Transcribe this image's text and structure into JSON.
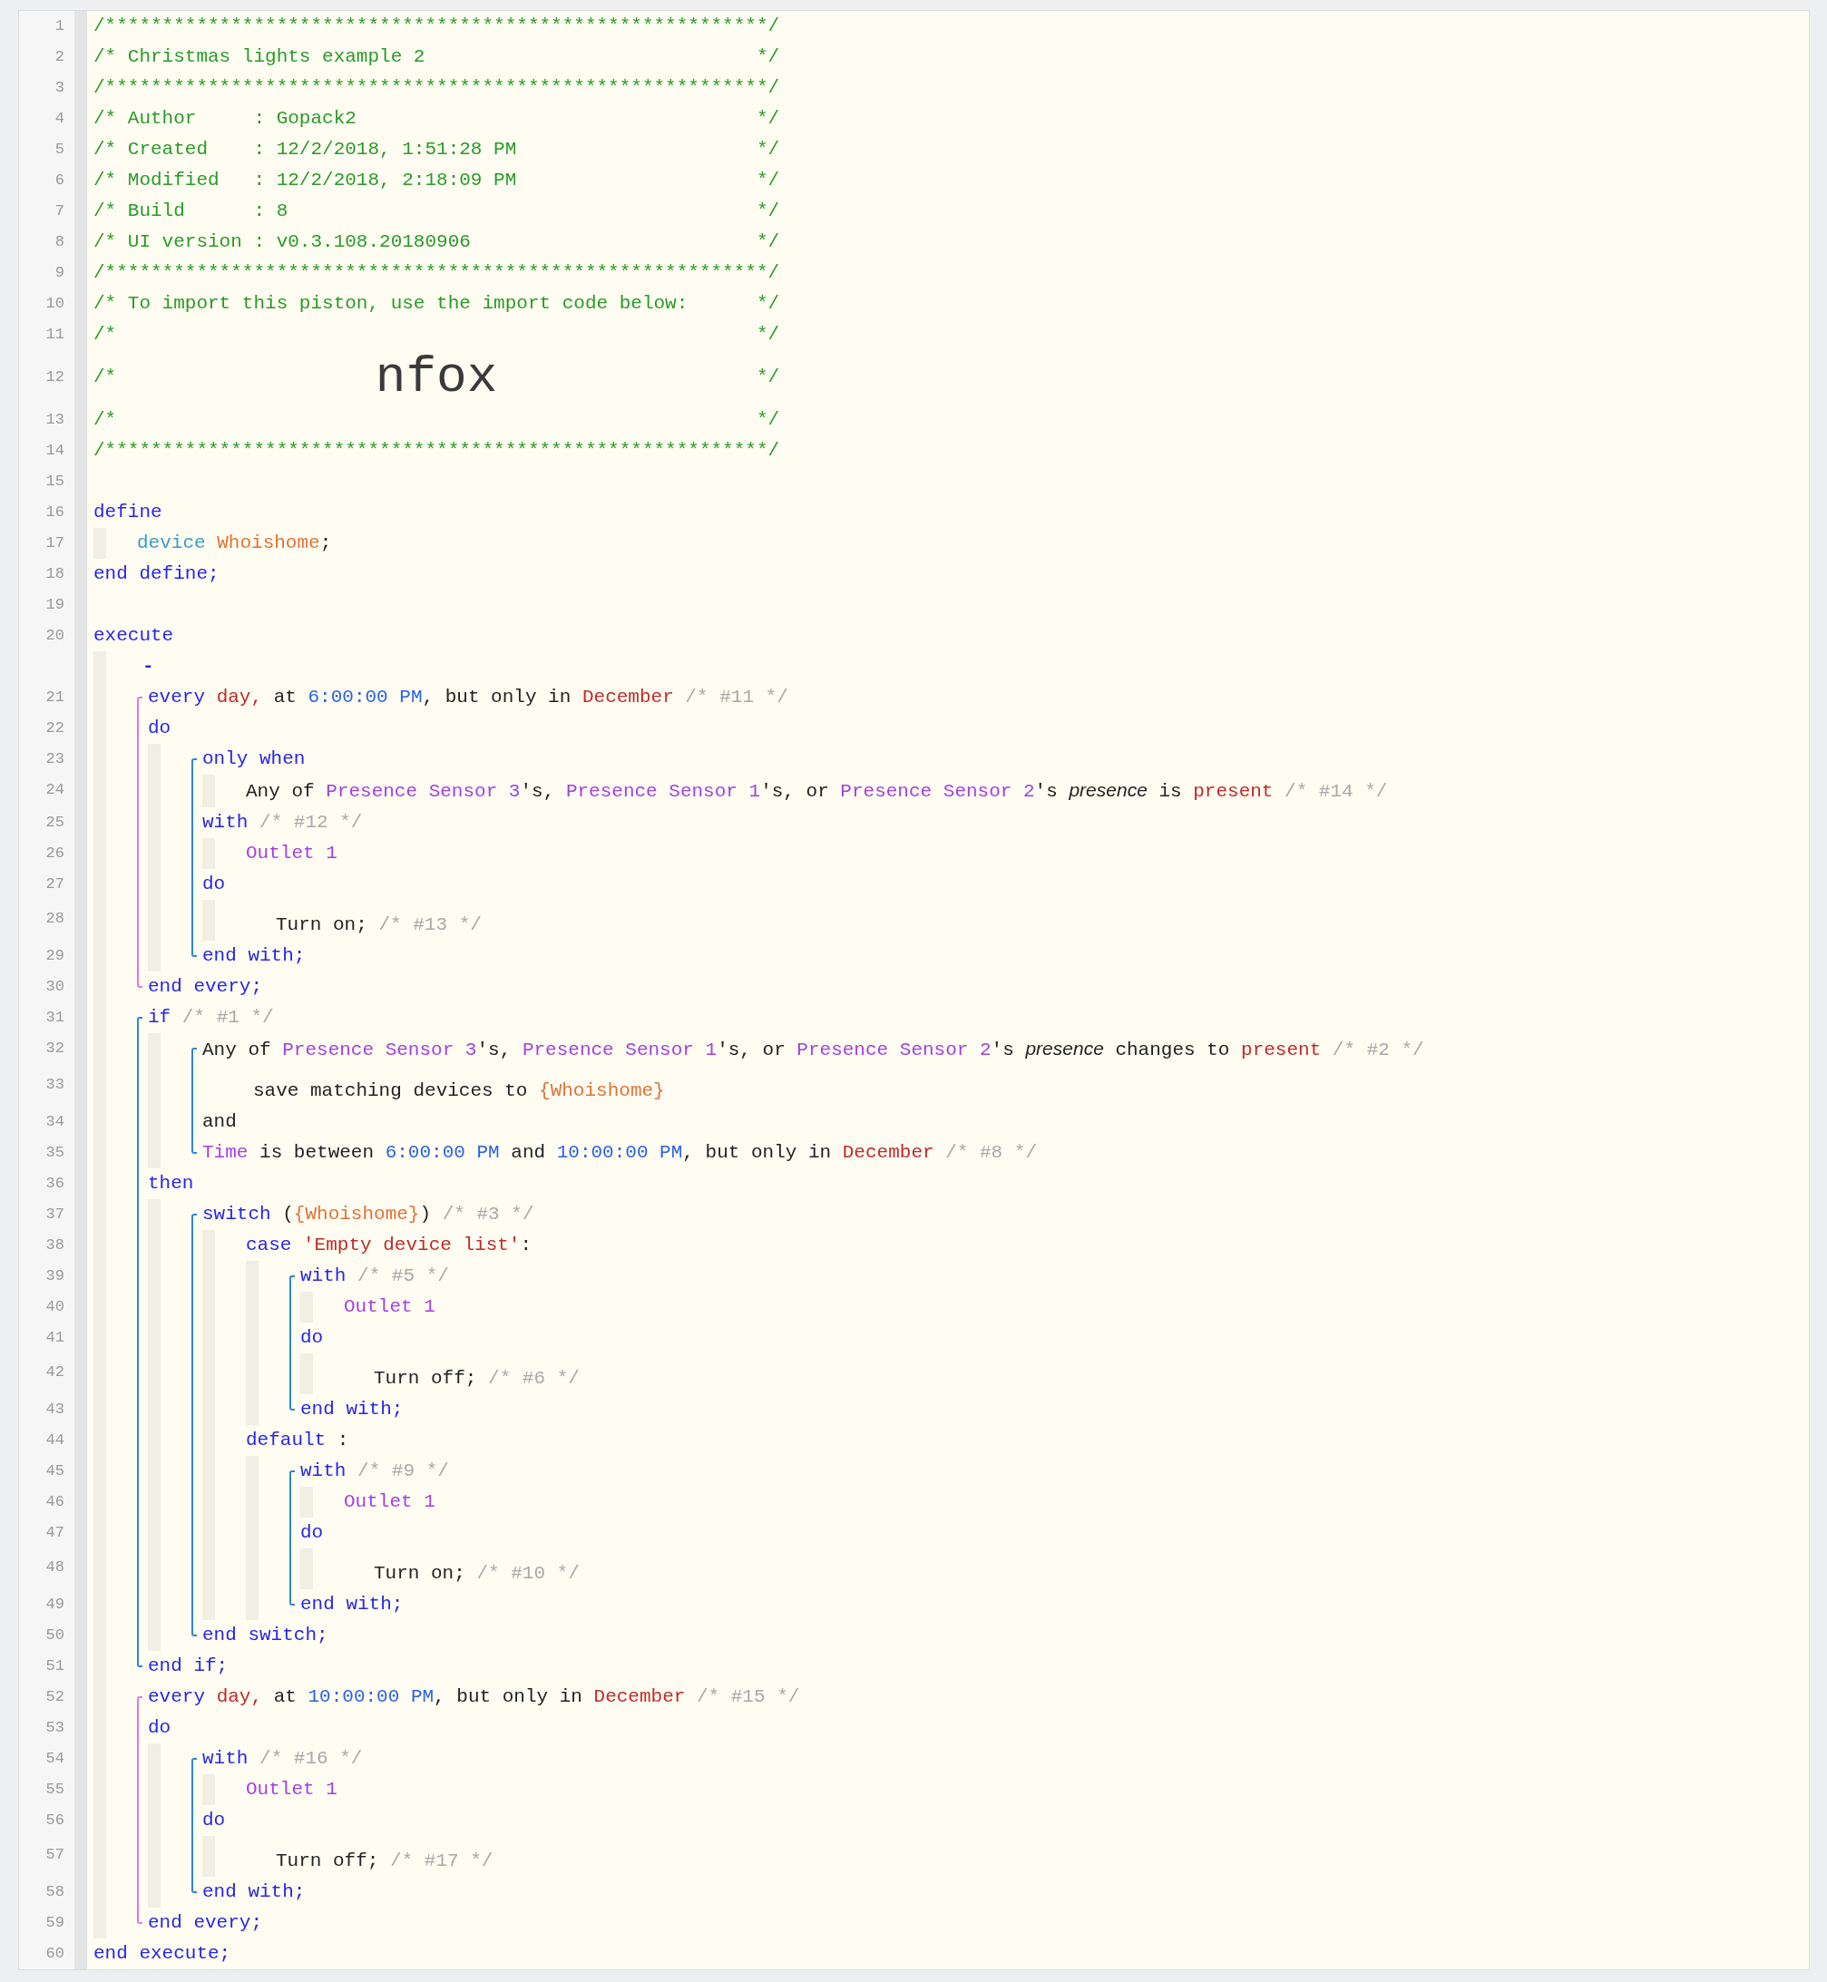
{
  "editor": {
    "lines": [
      {
        "kind": "box",
        "number": "1",
        "tokens": [
          {
            "text": "/**********************************************************/",
            "kind": "comment"
          }
        ]
      },
      {
        "kind": "box",
        "number": "2",
        "tokens": [
          {
            "text": "/* Christmas lights example 2",
            "kind": "comment"
          },
          {
            "text": "*/",
            "kind": "comment"
          }
        ]
      },
      {
        "kind": "box",
        "number": "3",
        "tokens": [
          {
            "text": "/**********************************************************/",
            "kind": "comment"
          }
        ]
      },
      {
        "kind": "box",
        "number": "4",
        "tokens": [
          {
            "text": "/* Author     : Gopack2",
            "kind": "comment"
          },
          {
            "text": "*/",
            "kind": "comment"
          }
        ]
      },
      {
        "kind": "box",
        "number": "5",
        "tokens": [
          {
            "text": "/* Created    : 12/2/2018, 1:51:28 PM",
            "kind": "comment"
          },
          {
            "text": "*/",
            "kind": "comment"
          }
        ]
      },
      {
        "kind": "box",
        "number": "6",
        "tokens": [
          {
            "text": "/* Modified   : 12/2/2018, 2:18:09 PM",
            "kind": "comment"
          },
          {
            "text": "*/",
            "kind": "comment"
          }
        ]
      },
      {
        "kind": "box",
        "number": "7",
        "tokens": [
          {
            "text": "/* Build      : 8",
            "kind": "comment"
          },
          {
            "text": "*/",
            "kind": "comment"
          }
        ]
      },
      {
        "kind": "box",
        "number": "8",
        "tokens": [
          {
            "text": "/* UI version : v0.3.108.20180906",
            "kind": "comment"
          },
          {
            "text": "*/",
            "kind": "comment"
          }
        ]
      },
      {
        "kind": "box",
        "number": "9",
        "tokens": [
          {
            "text": "/**********************************************************/",
            "kind": "comment"
          }
        ]
      },
      {
        "kind": "box",
        "number": "10",
        "tokens": [
          {
            "text": "/* To import this piston, use the import code below:",
            "kind": "comment"
          },
          {
            "text": "*/",
            "kind": "comment"
          }
        ]
      },
      {
        "kind": "box",
        "number": "11",
        "tokens": [
          {
            "text": "/*",
            "kind": "comment"
          },
          {
            "text": "*/",
            "kind": "comment"
          }
        ]
      },
      {
        "kind": "box",
        "number": "12",
        "tokens": [
          {
            "text": "/*",
            "kind": "comment"
          },
          {
            "text": "nfox",
            "kind": "import-code"
          },
          {
            "text": "*/",
            "kind": "comment"
          }
        ]
      },
      {
        "kind": "box",
        "number": "13",
        "tokens": [
          {
            "text": "/*",
            "kind": "comment"
          },
          {
            "text": "*/",
            "kind": "comment"
          }
        ]
      },
      {
        "kind": "box",
        "number": "14",
        "tokens": [
          {
            "text": "/**********************************************************/",
            "kind": "comment"
          }
        ]
      },
      {
        "kind": "gap",
        "number": "15"
      },
      {
        "kind": "line",
        "number": "16",
        "tokens": [
          {
            "text": "define",
            "kind": "keyword"
          }
        ]
      },
      {
        "kind": "body",
        "items": [
          {
            "kind": "line",
            "number": "17",
            "tokens": [
              {
                "text": "device ",
                "kind": "device-keyword"
              },
              {
                "text": "Whoishome",
                "kind": "variable"
              },
              {
                "text": ";",
                "kind": "plain"
              }
            ]
          }
        ]
      },
      {
        "kind": "line",
        "number": "18",
        "tokens": [
          {
            "text": "end define;",
            "kind": "keyword"
          }
        ]
      },
      {
        "kind": "gap",
        "number": "19"
      },
      {
        "kind": "line",
        "number": "20",
        "tokens": [
          {
            "text": "execute",
            "kind": "keyword"
          }
        ]
      },
      {
        "kind": "body",
        "items": [
          {
            "kind": "marker",
            "tokens": [
              {
                "text": "-",
                "kind": "keyword"
              }
            ]
          },
          {
            "kind": "bracket",
            "color": "#e07be0",
            "items": [
              {
                "kind": "line",
                "number": "21",
                "tokens": [
                  {
                    "text": "every ",
                    "kind": "keyword"
                  },
                  {
                    "text": "day,",
                    "kind": "literal"
                  },
                  {
                    "text": " at ",
                    "kind": "plain"
                  },
                  {
                    "text": "6:00:00 PM",
                    "kind": "time"
                  },
                  {
                    "text": ", but only in ",
                    "kind": "plain"
                  },
                  {
                    "text": "December",
                    "kind": "literal"
                  },
                  {
                    "text": " /* #11 */",
                    "kind": "note"
                  }
                ]
              },
              {
                "kind": "line",
                "number": "22",
                "tokens": [
                  {
                    "text": "do",
                    "kind": "keyword"
                  }
                ]
              },
              {
                "kind": "body",
                "items": [
                  {
                    "kind": "bracket",
                    "color": "#2b86e0",
                    "items": [
                      {
                        "kind": "line",
                        "number": "23",
                        "tokens": [
                          {
                            "text": "only when",
                            "kind": "keyword"
                          }
                        ]
                      },
                      {
                        "kind": "body",
                        "items": [
                          {
                            "kind": "line",
                            "number": "24",
                            "tokens": [
                              {
                                "text": "Any of ",
                                "kind": "plain"
                              },
                              {
                                "text": "Presence Sensor 3",
                                "kind": "device"
                              },
                              {
                                "text": "'s, ",
                                "kind": "plain"
                              },
                              {
                                "text": "Presence Sensor 1",
                                "kind": "device"
                              },
                              {
                                "text": "'s, or ",
                                "kind": "plain"
                              },
                              {
                                "text": "Presence Sensor 2",
                                "kind": "device"
                              },
                              {
                                "text": "'s ",
                                "kind": "plain"
                              },
                              {
                                "text": "presence",
                                "kind": "emphasis"
                              },
                              {
                                "text": " is ",
                                "kind": "plain"
                              },
                              {
                                "text": "present",
                                "kind": "literal"
                              },
                              {
                                "text": " /* #14 */",
                                "kind": "note"
                              }
                            ]
                          }
                        ]
                      },
                      {
                        "kind": "line",
                        "number": "25",
                        "tokens": [
                          {
                            "text": "with",
                            "kind": "keyword"
                          },
                          {
                            "text": " /* #12 */",
                            "kind": "note"
                          }
                        ]
                      },
                      {
                        "kind": "body",
                        "items": [
                          {
                            "kind": "line",
                            "number": "26",
                            "tokens": [
                              {
                                "text": "Outlet 1",
                                "kind": "device"
                              }
                            ]
                          }
                        ]
                      },
                      {
                        "kind": "line",
                        "number": "27",
                        "tokens": [
                          {
                            "text": "do",
                            "kind": "keyword"
                          }
                        ]
                      },
                      {
                        "kind": "body",
                        "items": [
                          {
                            "kind": "task",
                            "number": "28",
                            "tokens": [
                              {
                                "text": "Turn on;",
                                "kind": "plain"
                              },
                              {
                                "text": " /* #13 */",
                                "kind": "note"
                              }
                            ]
                          }
                        ]
                      },
                      {
                        "kind": "line",
                        "number": "29",
                        "tokens": [
                          {
                            "text": "end with;",
                            "kind": "keyword"
                          }
                        ]
                      }
                    ]
                  }
                ]
              },
              {
                "kind": "line",
                "number": "30",
                "tokens": [
                  {
                    "text": "end every;",
                    "kind": "keyword"
                  }
                ]
              }
            ]
          },
          {
            "kind": "bracket",
            "color": "#2b86e0",
            "items": [
              {
                "kind": "line",
                "number": "31",
                "tokens": [
                  {
                    "text": "if",
                    "kind": "keyword"
                  },
                  {
                    "text": " /* #1 */",
                    "kind": "note"
                  }
                ]
              },
              {
                "kind": "body",
                "items": [
                  {
                    "kind": "bracket",
                    "color": "#2b86e0",
                    "items": [
                      {
                        "kind": "line",
                        "number": "32",
                        "tokens": [
                          {
                            "text": "Any of ",
                            "kind": "plain"
                          },
                          {
                            "text": "Presence Sensor 3",
                            "kind": "device"
                          },
                          {
                            "text": "'s, ",
                            "kind": "plain"
                          },
                          {
                            "text": "Presence Sensor 1",
                            "kind": "device"
                          },
                          {
                            "text": "'s, or ",
                            "kind": "plain"
                          },
                          {
                            "text": "Presence Sensor 2",
                            "kind": "device"
                          },
                          {
                            "text": "'s ",
                            "kind": "plain"
                          },
                          {
                            "text": "presence",
                            "kind": "emphasis"
                          },
                          {
                            "text": " changes to ",
                            "kind": "plain"
                          },
                          {
                            "text": "present",
                            "kind": "literal"
                          },
                          {
                            "text": " /* #2 */",
                            "kind": "note"
                          }
                        ]
                      },
                      {
                        "kind": "sub",
                        "number": "33",
                        "tokens": [
                          {
                            "text": "save matching devices to ",
                            "kind": "plain"
                          },
                          {
                            "text": "{Whoishome}",
                            "kind": "variable"
                          }
                        ]
                      },
                      {
                        "kind": "line",
                        "number": "34",
                        "tokens": [
                          {
                            "text": "and",
                            "kind": "plain"
                          }
                        ]
                      },
                      {
                        "kind": "line",
                        "number": "35",
                        "tokens": [
                          {
                            "text": "Time",
                            "kind": "device"
                          },
                          {
                            "text": " is between ",
                            "kind": "plain"
                          },
                          {
                            "text": "6:00:00 PM",
                            "kind": "time"
                          },
                          {
                            "text": " and ",
                            "kind": "plain"
                          },
                          {
                            "text": "10:00:00 PM",
                            "kind": "time"
                          },
                          {
                            "text": ", but only in ",
                            "kind": "plain"
                          },
                          {
                            "text": "December",
                            "kind": "literal"
                          },
                          {
                            "text": " /* #8 */",
                            "kind": "note"
                          }
                        ]
                      }
                    ]
                  }
                ]
              },
              {
                "kind": "line",
                "number": "36",
                "tokens": [
                  {
                    "text": "then",
                    "kind": "keyword"
                  }
                ]
              },
              {
                "kind": "body",
                "items": [
                  {
                    "kind": "bracket",
                    "color": "#2b86e0",
                    "items": [
                      {
                        "kind": "line",
                        "number": "37",
                        "tokens": [
                          {
                            "text": "switch",
                            "kind": "keyword"
                          },
                          {
                            "text": " (",
                            "kind": "plain"
                          },
                          {
                            "text": "{Whoishome}",
                            "kind": "variable"
                          },
                          {
                            "text": ")",
                            "kind": "plain"
                          },
                          {
                            "text": " /* #3 */",
                            "kind": "note"
                          }
                        ]
                      },
                      {
                        "kind": "body",
                        "items": [
                          {
                            "kind": "line",
                            "number": "38",
                            "tokens": [
                              {
                                "text": "case ",
                                "kind": "keyword"
                              },
                              {
                                "text": "'Empty device list'",
                                "kind": "literal"
                              },
                              {
                                "text": ":",
                                "kind": "plain"
                              }
                            ]
                          },
                          {
                            "kind": "body",
                            "items": [
                              {
                                "kind": "bracket",
                                "color": "#2b86e0",
                                "items": [
                                  {
                                    "kind": "line",
                                    "number": "39",
                                    "tokens": [
                                      {
                                        "text": "with",
                                        "kind": "keyword"
                                      },
                                      {
                                        "text": " /* #5 */",
                                        "kind": "note"
                                      }
                                    ]
                                  },
                                  {
                                    "kind": "body",
                                    "items": [
                                      {
                                        "kind": "line",
                                        "number": "40",
                                        "tokens": [
                                          {
                                            "text": "Outlet 1",
                                            "kind": "device"
                                          }
                                        ]
                                      }
                                    ]
                                  },
                                  {
                                    "kind": "line",
                                    "number": "41",
                                    "tokens": [
                                      {
                                        "text": "do",
                                        "kind": "keyword"
                                      }
                                    ]
                                  },
                                  {
                                    "kind": "body",
                                    "items": [
                                      {
                                        "kind": "task",
                                        "number": "42",
                                        "tokens": [
                                          {
                                            "text": "Turn off;",
                                            "kind": "plain"
                                          },
                                          {
                                            "text": " /* #6 */",
                                            "kind": "note"
                                          }
                                        ]
                                      }
                                    ]
                                  },
                                  {
                                    "kind": "line",
                                    "number": "43",
                                    "tokens": [
                                      {
                                        "text": "end with;",
                                        "kind": "keyword"
                                      }
                                    ]
                                  }
                                ]
                              }
                            ]
                          },
                          {
                            "kind": "line",
                            "number": "44",
                            "tokens": [
                              {
                                "text": "default",
                                "kind": "keyword"
                              },
                              {
                                "text": " :",
                                "kind": "plain"
                              }
                            ]
                          },
                          {
                            "kind": "body",
                            "items": [
                              {
                                "kind": "bracket",
                                "color": "#2b86e0",
                                "items": [
                                  {
                                    "kind": "line",
                                    "number": "45",
                                    "tokens": [
                                      {
                                        "text": "with",
                                        "kind": "keyword"
                                      },
                                      {
                                        "text": " /* #9 */",
                                        "kind": "note"
                                      }
                                    ]
                                  },
                                  {
                                    "kind": "body",
                                    "items": [
                                      {
                                        "kind": "line",
                                        "number": "46",
                                        "tokens": [
                                          {
                                            "text": "Outlet 1",
                                            "kind": "device"
                                          }
                                        ]
                                      }
                                    ]
                                  },
                                  {
                                    "kind": "line",
                                    "number": "47",
                                    "tokens": [
                                      {
                                        "text": "do",
                                        "kind": "keyword"
                                      }
                                    ]
                                  },
                                  {
                                    "kind": "body",
                                    "items": [
                                      {
                                        "kind": "task",
                                        "number": "48",
                                        "tokens": [
                                          {
                                            "text": "Turn on;",
                                            "kind": "plain"
                                          },
                                          {
                                            "text": " /* #10 */",
                                            "kind": "note"
                                          }
                                        ]
                                      }
                                    ]
                                  },
                                  {
                                    "kind": "line",
                                    "number": "49",
                                    "tokens": [
                                      {
                                        "text": "end with;",
                                        "kind": "keyword"
                                      }
                                    ]
                                  }
                                ]
                              }
                            ]
                          }
                        ]
                      },
                      {
                        "kind": "line",
                        "number": "50",
                        "tokens": [
                          {
                            "text": "end switch;",
                            "kind": "keyword"
                          }
                        ]
                      }
                    ]
                  }
                ]
              },
              {
                "kind": "line",
                "number": "51",
                "tokens": [
                  {
                    "text": "end if;",
                    "kind": "keyword"
                  }
                ]
              }
            ]
          },
          {
            "kind": "bracket",
            "color": "#e07be0",
            "items": [
              {
                "kind": "line",
                "number": "52",
                "tokens": [
                  {
                    "text": "every ",
                    "kind": "keyword"
                  },
                  {
                    "text": "day,",
                    "kind": "literal"
                  },
                  {
                    "text": " at ",
                    "kind": "plain"
                  },
                  {
                    "text": "10:00:00 PM",
                    "kind": "time"
                  },
                  {
                    "text": ", but only in ",
                    "kind": "plain"
                  },
                  {
                    "text": "December",
                    "kind": "literal"
                  },
                  {
                    "text": " /* #15 */",
                    "kind": "note"
                  }
                ]
              },
              {
                "kind": "line",
                "number": "53",
                "tokens": [
                  {
                    "text": "do",
                    "kind": "keyword"
                  }
                ]
              },
              {
                "kind": "body",
                "items": [
                  {
                    "kind": "bracket",
                    "color": "#2b86e0",
                    "items": [
                      {
                        "kind": "line",
                        "number": "54",
                        "tokens": [
                          {
                            "text": "with",
                            "kind": "keyword"
                          },
                          {
                            "text": " /* #16 */",
                            "kind": "note"
                          }
                        ]
                      },
                      {
                        "kind": "body",
                        "items": [
                          {
                            "kind": "line",
                            "number": "55",
                            "tokens": [
                              {
                                "text": "Outlet 1",
                                "kind": "device"
                              }
                            ]
                          }
                        ]
                      },
                      {
                        "kind": "line",
                        "number": "56",
                        "tokens": [
                          {
                            "text": "do",
                            "kind": "keyword"
                          }
                        ]
                      },
                      {
                        "kind": "body",
                        "items": [
                          {
                            "kind": "task",
                            "number": "57",
                            "tokens": [
                              {
                                "text": "Turn off;",
                                "kind": "plain"
                              },
                              {
                                "text": " /* #17 */",
                                "kind": "note"
                              }
                            ]
                          }
                        ]
                      },
                      {
                        "kind": "line",
                        "number": "58",
                        "tokens": [
                          {
                            "text": "end with;",
                            "kind": "keyword"
                          }
                        ]
                      }
                    ]
                  }
                ]
              },
              {
                "kind": "line",
                "number": "59",
                "tokens": [
                  {
                    "text": "end every;",
                    "kind": "keyword"
                  }
                ]
              }
            ]
          }
        ]
      },
      {
        "kind": "line",
        "number": "60",
        "tokens": [
          {
            "text": "end execute;",
            "kind": "keyword"
          }
        ]
      }
    ]
  }
}
